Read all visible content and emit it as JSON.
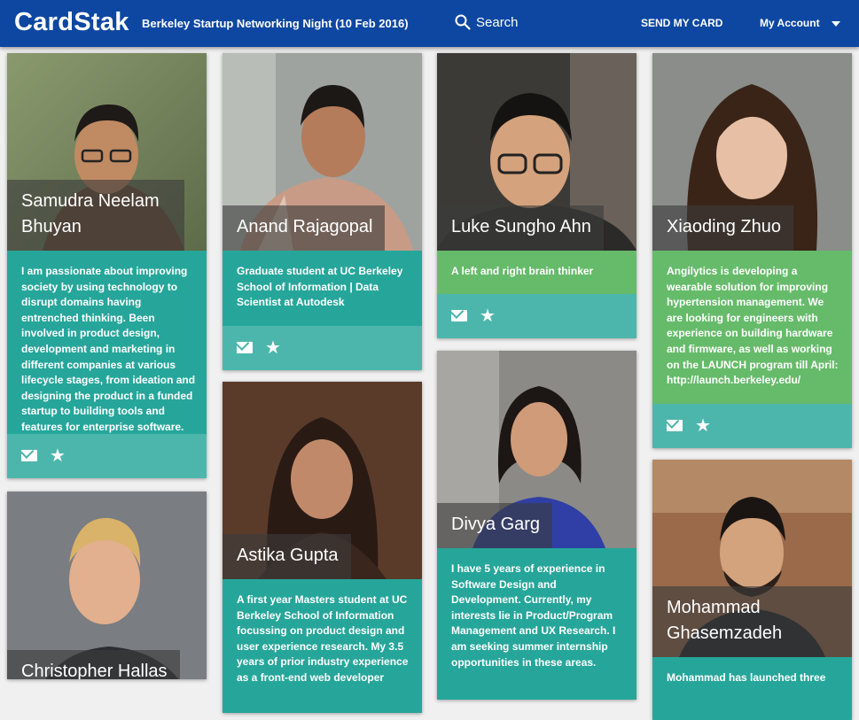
{
  "app": {
    "logo": "CardStak"
  },
  "header": {
    "event_title": "Berkeley Startup Networking Night (10 Feb 2016)",
    "search_label": "Search",
    "send_card_label": "SEND MY CARD",
    "account_label": "My Account"
  },
  "icons": {
    "search": "search-icon",
    "mail": "mail-icon",
    "star": "star-icon",
    "dropdown": "caret-down-icon"
  },
  "colors": {
    "navbar": "#0d47a1",
    "teal": "#26a69a",
    "green": "#66bb6a",
    "action_bar": "#4db6ac"
  },
  "cards": [
    {
      "name": "Samudra Neelam Bhuyan",
      "description": "I am passionate about improving society by using technology to disrupt domains having entrenched thinking. Been involved in product design, development and marketing in different companies at various lifecycle stages, from ideation and designing the product in a funded startup to building tools and features for enterprise software."
    },
    {
      "name": "Anand Rajagopal",
      "description": "Graduate student at UC Berkeley School of Information | Data Scientist at Autodesk"
    },
    {
      "name": "Luke Sungho Ahn",
      "description": "A left and right brain thinker"
    },
    {
      "name": "Xiaoding Zhuo",
      "description": "Angilytics is developing a wearable solution for improving hypertension management. We are looking for engineers with experience on building hardware and firmware, as well as working on the LAUNCH program till April: http://launch.berkeley.edu/"
    },
    {
      "name": "Christopher Hallas",
      "description": ""
    },
    {
      "name": "Astika Gupta",
      "description": "A first year Masters student at UC Berkeley School of Information focussing on product design and user experience research. My 3.5 years of prior industry experience as a front-end web developer"
    },
    {
      "name": "Divya Garg",
      "description": "I have 5 years of experience in Software Design and Development. Currently, my interests lie in Product/Program Management and UX Research. I am seeking summer internship opportunities in these areas."
    },
    {
      "name": "Mohammad Ghasemzadeh",
      "description": "Mohammad has launched three"
    }
  ]
}
